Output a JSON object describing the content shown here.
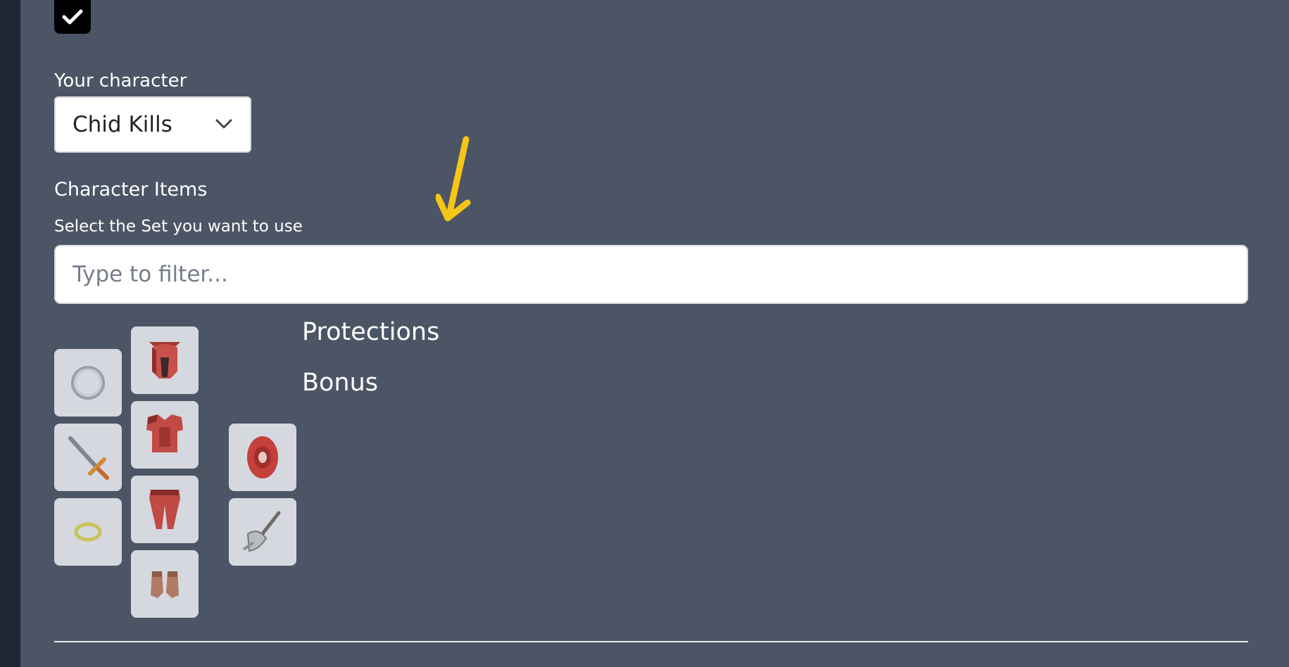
{
  "checkbox": {
    "checked": true
  },
  "character": {
    "label": "Your character",
    "selected": "Chid Kills"
  },
  "items": {
    "heading": "Character Items",
    "hint": "Select the Set you want to use",
    "filter_placeholder": "Type to filter..."
  },
  "equipment_slots": [
    {
      "slot": "necklace",
      "icon": "necklace-icon"
    },
    {
      "slot": "helmet",
      "icon": "helmet-icon"
    },
    {
      "slot": "weapon",
      "icon": "sword-icon"
    },
    {
      "slot": "armor",
      "icon": "armor-icon"
    },
    {
      "slot": "shield",
      "icon": "shield-icon"
    },
    {
      "slot": "ring",
      "icon": "ring-icon"
    },
    {
      "slot": "legs",
      "icon": "legs-icon"
    },
    {
      "slot": "ammo",
      "icon": "crossbow-icon"
    },
    {
      "slot": "boots",
      "icon": "boots-icon"
    }
  ],
  "sections": {
    "protections": "Protections",
    "bonus": "Bonus"
  },
  "colors": {
    "background": "#4c5565",
    "sidebar": "#1f2532",
    "slot": "#d5d8de",
    "annotation_arrow": "#f5c518"
  }
}
